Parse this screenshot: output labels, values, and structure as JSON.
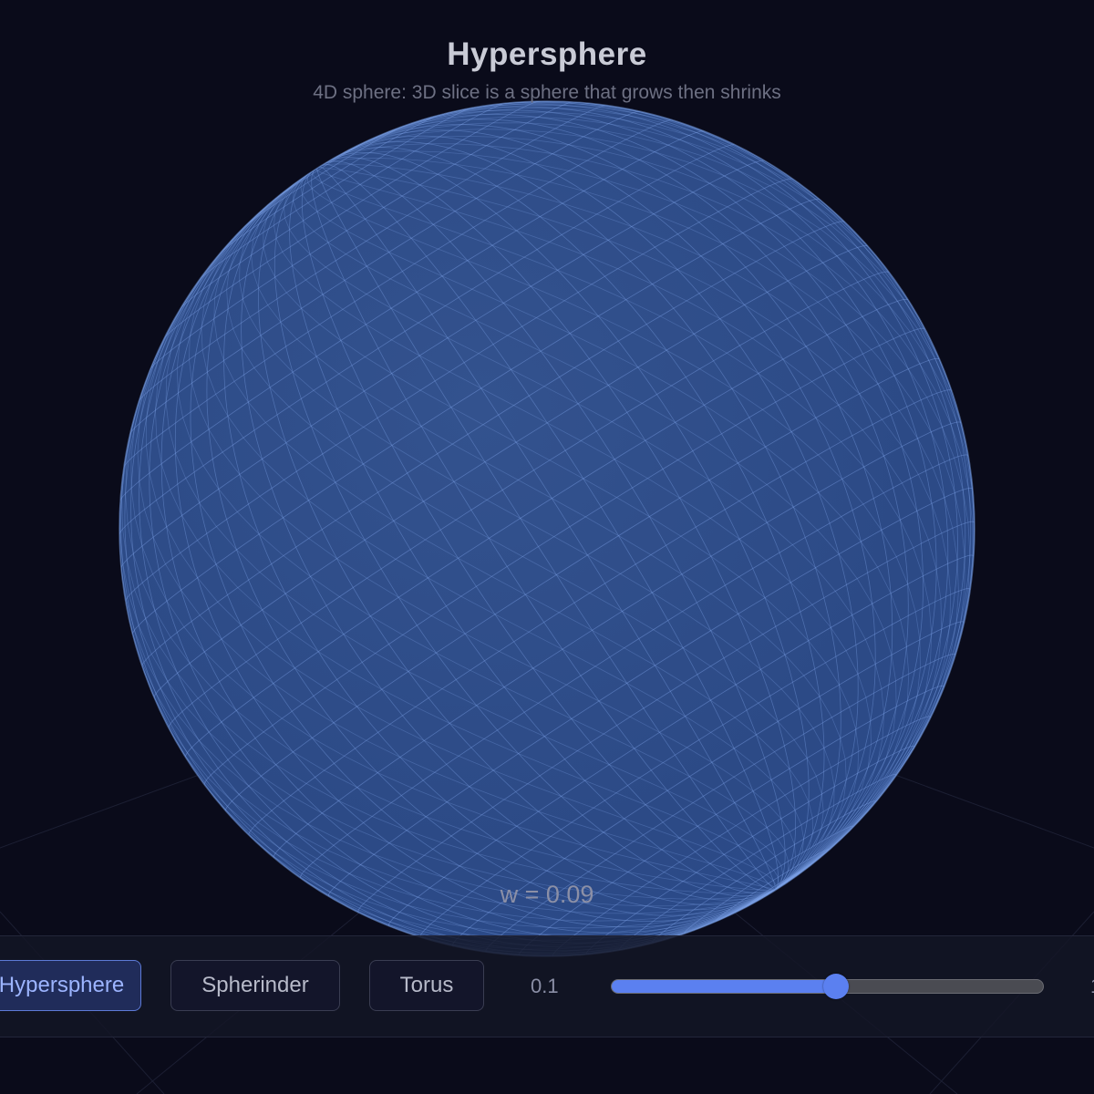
{
  "header": {
    "title": "Hypersphere",
    "subtitle": "4D sphere: 3D slice is a sphere that grows then shrinks"
  },
  "viewport": {
    "w_label": "w = 0.09",
    "shape": "sphere-wireframe",
    "sphere_color": "#2e4d88",
    "wire_color": "#7ea2e8"
  },
  "controls": {
    "shapes": [
      {
        "label": "Hypersphere",
        "active": true
      },
      {
        "label": "Spherinder",
        "active": false
      },
      {
        "label": "Torus",
        "active": false
      }
    ],
    "slider": {
      "min_label": "0.1",
      "fraction": 0.52,
      "accent": "#5b80f0"
    }
  }
}
